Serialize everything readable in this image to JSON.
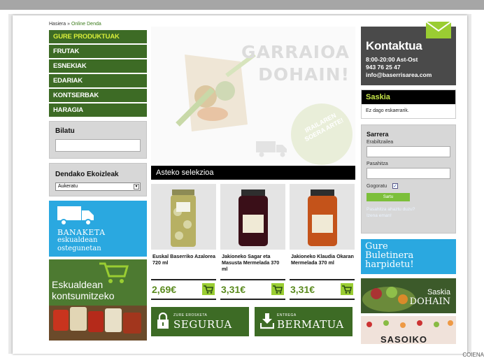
{
  "breadcrumb": {
    "home": "Hasiera",
    "sep": "»",
    "current": "Online Denda"
  },
  "menu": [
    {
      "label": "GURE PRODUKTUAK"
    },
    {
      "label": "FRUTAK"
    },
    {
      "label": "ESNEKIAK"
    },
    {
      "label": "EDARIAK"
    },
    {
      "label": "KONTSERBAK"
    },
    {
      "label": "HARAGIA"
    }
  ],
  "search": {
    "title": "Bilatu",
    "value": ""
  },
  "producers": {
    "title": "Dendako Ekoizleak",
    "selected": "Aukeratu"
  },
  "banaketa": {
    "line1": "BANAKETA",
    "line2": "eskualdean",
    "line3": "ostegunetan"
  },
  "eskualdean": {
    "line1": "Eskualdean",
    "line2": "kontsumitzeko"
  },
  "hero": {
    "line1": "GARRAIOA",
    "line2": "DOHAIN!",
    "stamp": "IRAILAREN SOERA ARTE!"
  },
  "weekly": {
    "title": "Asteko selekzioa",
    "products": [
      {
        "name": "Euskal Baserriko Azalorea 720 ml",
        "price": "2,69€"
      },
      {
        "name": "Jakioneko Sagar eta Masusta Mermelada 370 ml",
        "price": "3,31€"
      },
      {
        "name": "Jakioneko Klaudia Okaran Mermelada 370 ml",
        "price": "3,31€"
      }
    ]
  },
  "badges": [
    {
      "small": "ZURE EROSKETA",
      "big": "SEGURUA"
    },
    {
      "small": "ENTREGA",
      "big": "BERMATUA"
    }
  ],
  "contact": {
    "title": "Kontaktua",
    "hours": "8:00-20:00 Ast-Ost",
    "phone": "943 76 25 47",
    "email": "info@baserrisarea.com"
  },
  "cart": {
    "title": "Saskia",
    "empty": "Ez dago eskaerarik."
  },
  "login": {
    "title": "Sarrera",
    "user_label": "Erabiltzailea",
    "pass_label": "Pasahitza",
    "remember_label": "Gogoratu",
    "submit": "Sartu",
    "forgot": "Pasahitza ahaztu duzu?",
    "register": "Izena eman!"
  },
  "newsletter": {
    "line1": "Gure",
    "line2": "Buletinera",
    "line3": "harpidetu!"
  },
  "saskia_ad": {
    "line1": "Saskia",
    "line2": "DOHAIN"
  },
  "sasoiko": {
    "label": "SASOIKO"
  },
  "footer_label": "COIENA",
  "colors": {
    "green": "#3d6b25",
    "lime": "#9acd32",
    "blue": "#2aa8e0",
    "dark": "#4a4a4a"
  }
}
